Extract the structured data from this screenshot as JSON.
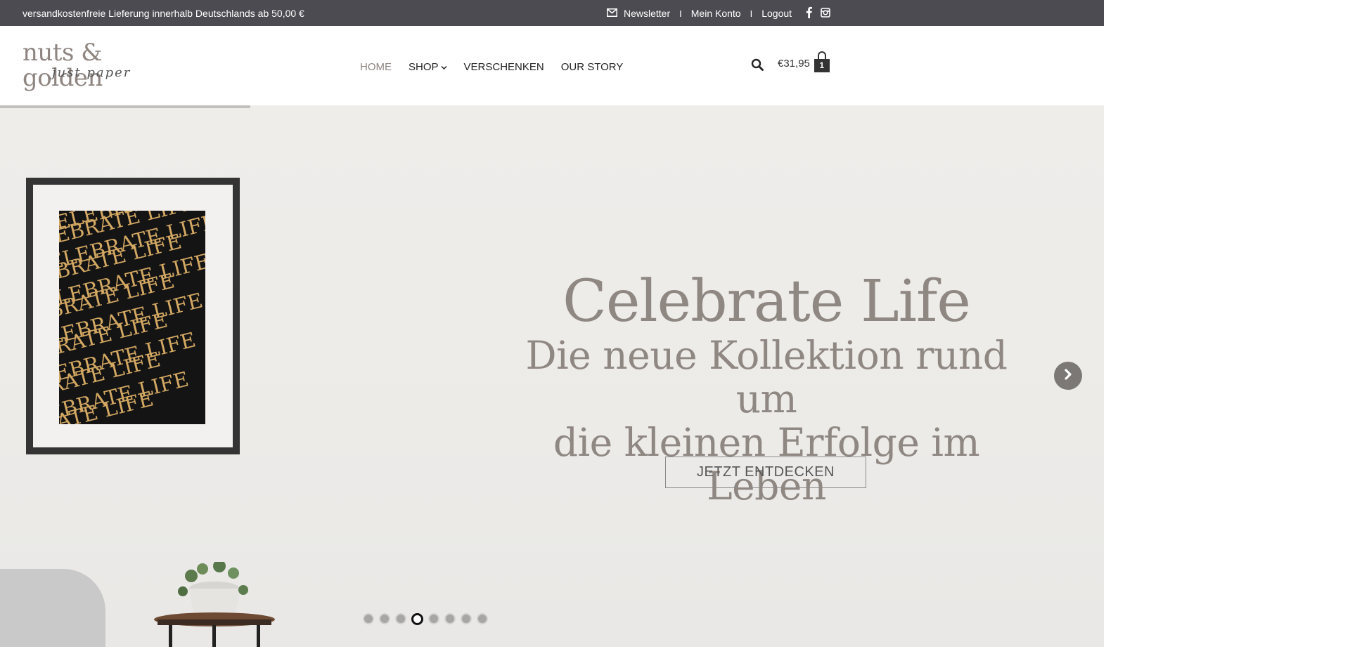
{
  "topbar": {
    "shipping_text": "versandkostenfreie Lieferung innerhalb Deutschlands ab 50,00 €",
    "newsletter": "Newsletter",
    "account": "Mein Konto",
    "logout": "Logout",
    "separator": "I",
    "icons": [
      "mail-icon",
      "facebook-icon",
      "instagram-icon"
    ]
  },
  "header": {
    "logo_main": "nuts & golden",
    "logo_sub": "just paper",
    "nav": [
      {
        "label": "HOME",
        "active": true
      },
      {
        "label": "SHOP",
        "has_dropdown": true
      },
      {
        "label": "VERSCHENKEN"
      },
      {
        "label": "OUR STORY"
      }
    ],
    "cart_total": "€31,95",
    "cart_count": "1"
  },
  "hero": {
    "title": "Celebrate Life",
    "subtitle_line1": "Die neue Kollektion rund um",
    "subtitle_line2": "die kleinen Erfolge im Leben",
    "cta": "JETZT ENTDECKEN",
    "poster_text": "CELEBRATE LIFE",
    "slides_total": 8,
    "active_slide": 4
  },
  "colors": {
    "topbar_bg": "#4b4b51",
    "accent_text": "#8f8782",
    "poster_gold": "#d3a863"
  }
}
